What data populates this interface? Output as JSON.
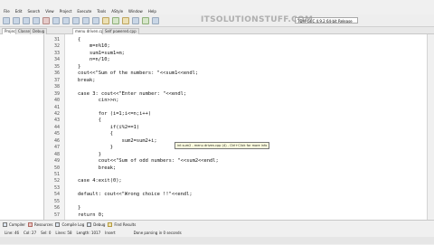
{
  "menu": [
    "File",
    "Edit",
    "Search",
    "View",
    "Project",
    "Execute",
    "Tools",
    "AStyle",
    "Window",
    "Help"
  ],
  "watermark": "ITSOLUTIONSTUFF.COM",
  "toolbar": {
    "compiler": "TDM-GCC 4.9.2 64-bit Release",
    "globals": "(globals)"
  },
  "left_tabs": [
    "Project",
    "Classes",
    "Debug"
  ],
  "file_tabs": [
    "menu driven.cpp",
    "Self powered.cpp"
  ],
  "lines": [
    {
      "n": "31",
      "text": "{"
    },
    {
      "n": "32",
      "text": "    m=n%10;"
    },
    {
      "n": "33",
      "text": "    sum1=sum1+m;"
    },
    {
      "n": "34",
      "text": "    n=n/10;"
    },
    {
      "n": "35",
      "text": "}"
    },
    {
      "n": "36",
      "text": "cout<<\"Sum of the numbers: \"<<sum1<<endl;"
    },
    {
      "n": "37",
      "text": "break;"
    },
    {
      "n": "38",
      "text": ""
    },
    {
      "n": "39",
      "text": "case 3: cout<<\"Enter number: \"<<endl;"
    },
    {
      "n": "40",
      "text": "       cin>>n;"
    },
    {
      "n": "41",
      "text": ""
    },
    {
      "n": "42",
      "text": "       for (i=1;i<=n;i++)"
    },
    {
      "n": "43",
      "text": "       {"
    },
    {
      "n": "44",
      "text": "           if(i%2==1)"
    },
    {
      "n": "45",
      "text": "           {"
    },
    {
      "n": "46",
      "text": "               sum2=sum2+i;"
    },
    {
      "n": "47",
      "text": "           }"
    },
    {
      "n": "48",
      "text": "       }"
    },
    {
      "n": "49",
      "text": "       cout<<\"Sum of odd numbers: \"<<sum2<<endl;"
    },
    {
      "n": "50",
      "text": "       break;"
    },
    {
      "n": "51",
      "text": ""
    },
    {
      "n": "52",
      "text": "case 4:exit(0);"
    },
    {
      "n": "53",
      "text": ""
    },
    {
      "n": "54",
      "text": "default: cout<<\"Wrong choice !!\"<<endl;"
    },
    {
      "n": "55",
      "text": ""
    },
    {
      "n": "56",
      "text": "}"
    },
    {
      "n": "57",
      "text": "return 0;"
    }
  ],
  "tooltip": "int sum2 - menu driven.cpp (4) - Ctrl+Click for more info",
  "bottom_tabs": [
    "Compiler",
    "Resources",
    "Compile Log",
    "Debug",
    "Find Results"
  ],
  "status": {
    "line": "Line: 46",
    "col": "Col: 27",
    "sel": "Sel: 0",
    "lines": "Lines: 58",
    "length": "Length: 1017",
    "mode": "Insert",
    "message": "Done parsing in 0 seconds"
  }
}
